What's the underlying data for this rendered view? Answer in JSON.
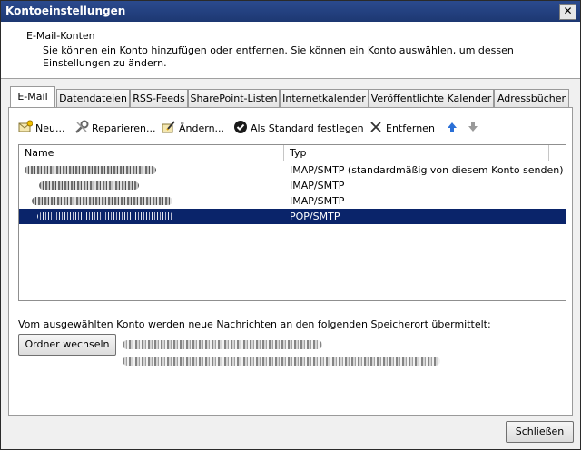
{
  "window": {
    "title": "Kontoeinstellungen",
    "close_glyph": "✕"
  },
  "header": {
    "title": "E-Mail-Konten",
    "description": "Sie können ein Konto hinzufügen oder entfernen. Sie können ein Konto auswählen, um dessen Einstellungen zu ändern."
  },
  "tabs": [
    "E-Mail",
    "Datendateien",
    "RSS-Feeds",
    "SharePoint-Listen",
    "Internetkalender",
    "Veröffentlichte Kalender",
    "Adressbücher"
  ],
  "toolbar": {
    "new": "Neu...",
    "repair": "Reparieren...",
    "change": "Ändern...",
    "default": "Als Standard festlegen",
    "remove": "Entfernen"
  },
  "list": {
    "col_name": "Name",
    "col_type": "Typ",
    "rows": [
      {
        "type": "IMAP/SMTP (standardmäßig von diesem Konto senden)"
      },
      {
        "type": "IMAP/SMTP"
      },
      {
        "type": "IMAP/SMTP"
      },
      {
        "type": "POP/SMTP"
      }
    ]
  },
  "delivery": {
    "note": "Vom ausgewählten Konto werden neue Nachrichten an den folgenden Speicherort übermittelt:",
    "change_folder": "Ordner wechseln"
  },
  "footer": {
    "close": "Schließen"
  },
  "colors": {
    "titlebar": "#1d3872",
    "selection": "#0a246a"
  },
  "icons": [
    "new-mail-icon",
    "repair-icon",
    "change-icon",
    "checkmark-icon",
    "delete-x-icon",
    "arrow-up-icon",
    "arrow-down-icon"
  ]
}
